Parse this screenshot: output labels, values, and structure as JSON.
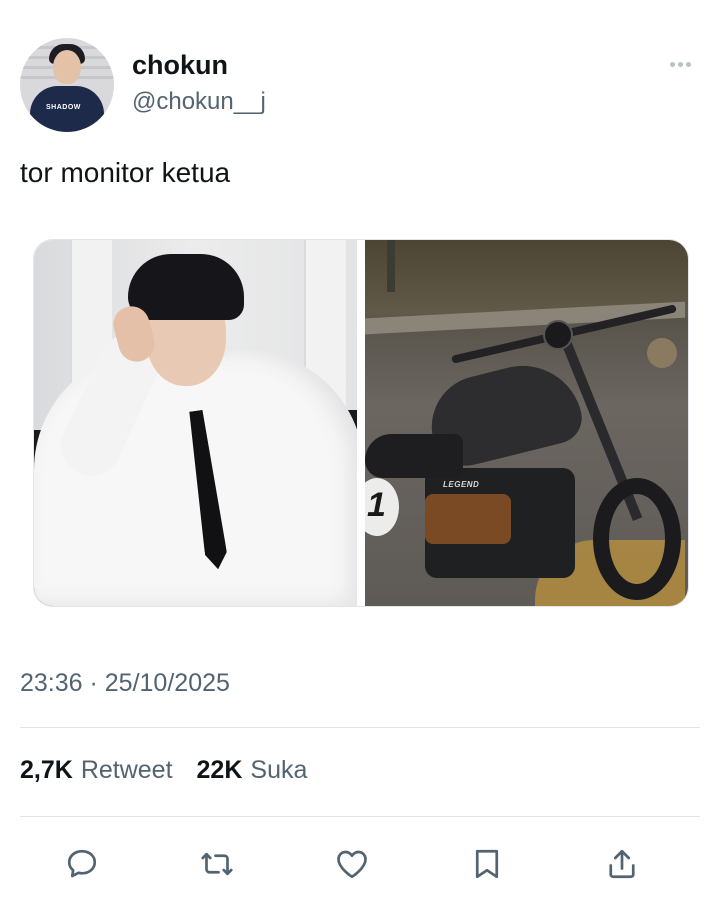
{
  "user": {
    "display_name": "chokun",
    "handle": "@chokun__j",
    "avatar_shirt_text": "SHADOW"
  },
  "tweet": {
    "text": "tor monitor ketua",
    "timestamp": "23:36 · 25/10/2025",
    "media": [
      {
        "description_icon": "photo-man-white-shirt"
      },
      {
        "description_icon": "photo-motorcycle",
        "visible_text": "1",
        "badge_text": "LEGEND"
      }
    ]
  },
  "stats": {
    "retweets_count": "2,7K",
    "retweets_label": "Retweet",
    "likes_count": "22K",
    "likes_label": "Suka"
  },
  "actions": [
    {
      "name": "reply",
      "icon": "speech-bubble-icon"
    },
    {
      "name": "retweet",
      "icon": "retweet-icon"
    },
    {
      "name": "like",
      "icon": "heart-icon"
    },
    {
      "name": "bookmark",
      "icon": "bookmark-icon"
    },
    {
      "name": "share",
      "icon": "share-icon"
    }
  ],
  "colors": {
    "text_primary": "#0f1419",
    "text_secondary": "#536471",
    "divider": "#e1e6ea"
  }
}
